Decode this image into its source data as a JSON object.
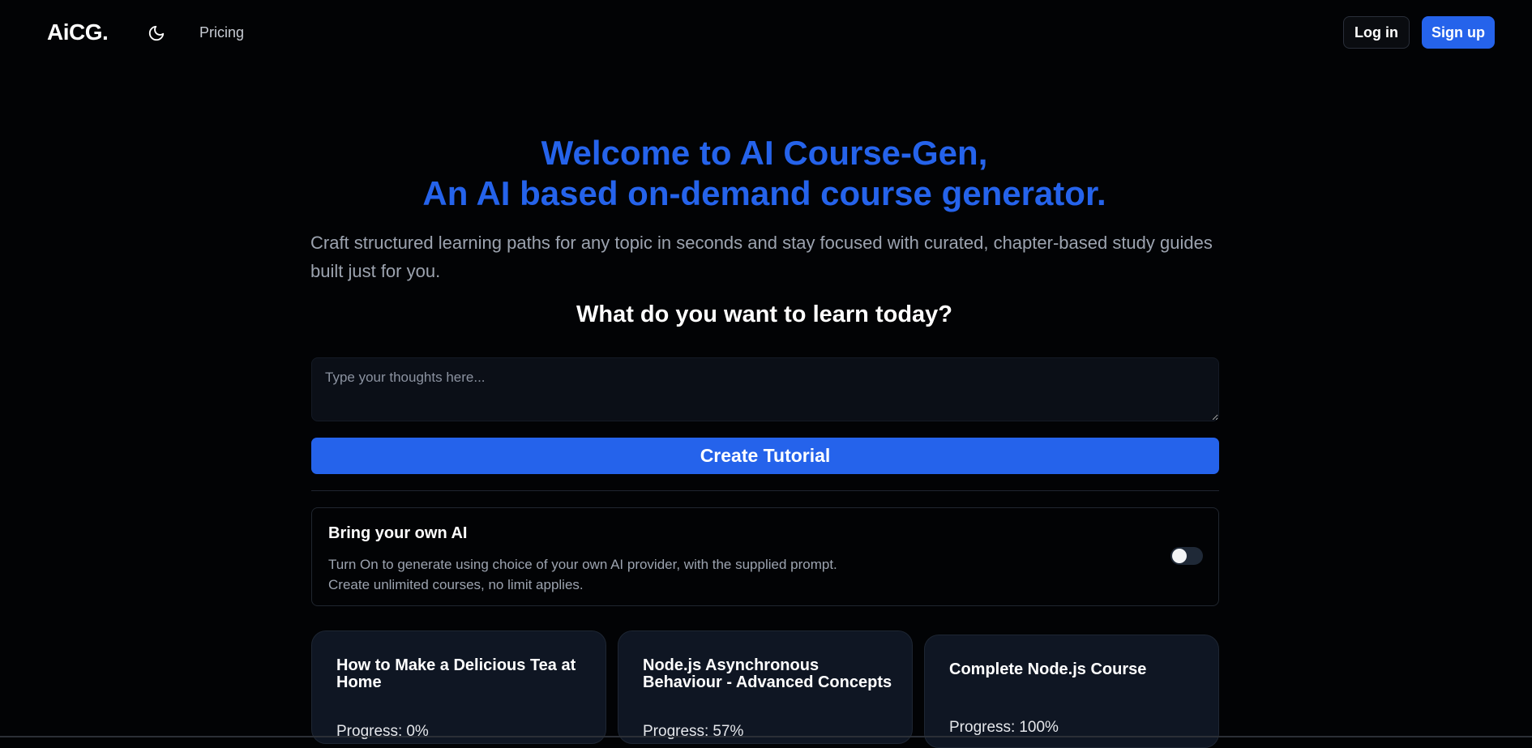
{
  "nav": {
    "logo": "AiCG.",
    "theme_icon": "moon-icon",
    "pricing": "Pricing",
    "login": "Log in",
    "signup": "Sign up"
  },
  "hero": {
    "title_line1": "Welcome to AI Course-Gen,",
    "title_line2": "An AI based on-demand course generator.",
    "subtitle": "Craft structured learning paths for any topic in seconds and stay focused with curated, chapter-based study guides built just for you.",
    "question": "What do you want to learn today?"
  },
  "form": {
    "placeholder": "Type your thoughts here...",
    "value": "",
    "create_button": "Create Tutorial"
  },
  "byo_ai": {
    "title": "Bring your own AI",
    "desc_line1": "Turn On to generate using choice of your own AI provider, with the supplied prompt.",
    "desc_line2": "Create unlimited courses, no limit applies.",
    "enabled": false
  },
  "courses": [
    {
      "title": "How to Make a Delicious Tea at Home",
      "progress_label": "Progress:",
      "progress": "0%"
    },
    {
      "title": "Node.js Asynchronous Behaviour - Advanced Concepts",
      "progress_label": "Progress:",
      "progress": "57%"
    },
    {
      "title": "Complete Node.js Course",
      "progress_label": "Progress:",
      "progress": "100%"
    }
  ],
  "colors": {
    "background": "#020305",
    "accent": "#2563eb",
    "card": "#0f1623",
    "muted_text": "#9ca3af"
  }
}
